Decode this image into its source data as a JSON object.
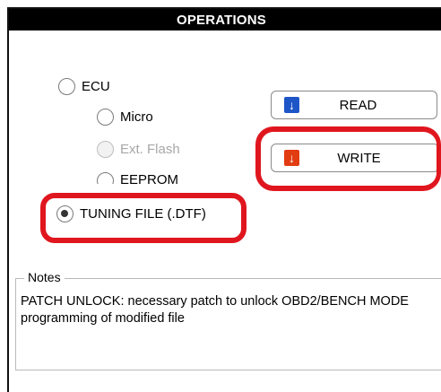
{
  "window": {
    "title": "OPERATIONS"
  },
  "targets": [
    {
      "key": "ecu",
      "label": "ECU",
      "selected": false,
      "disabled": false
    },
    {
      "key": "micro",
      "label": "Micro",
      "selected": false,
      "disabled": false
    },
    {
      "key": "ext_flash",
      "label": "Ext. Flash",
      "selected": false,
      "disabled": true
    },
    {
      "key": "eeprom",
      "label": "EEPROM",
      "selected": false,
      "disabled": false
    },
    {
      "key": "tuning_file",
      "label": "TUNING FILE (.DTF)",
      "selected": true,
      "disabled": false
    }
  ],
  "actions": {
    "read_label": "READ",
    "read_icon": "download-arrow-icon",
    "read_color": "#1e56c8",
    "write_label": "WRITE",
    "write_icon": "download-arrow-icon",
    "write_color": "#e23c12"
  },
  "highlight_color": "#e0161e",
  "notes": {
    "title": "Notes",
    "text": "PATCH UNLOCK: necessary patch to unlock OBD2/BENCH MODE programming of modified file"
  }
}
